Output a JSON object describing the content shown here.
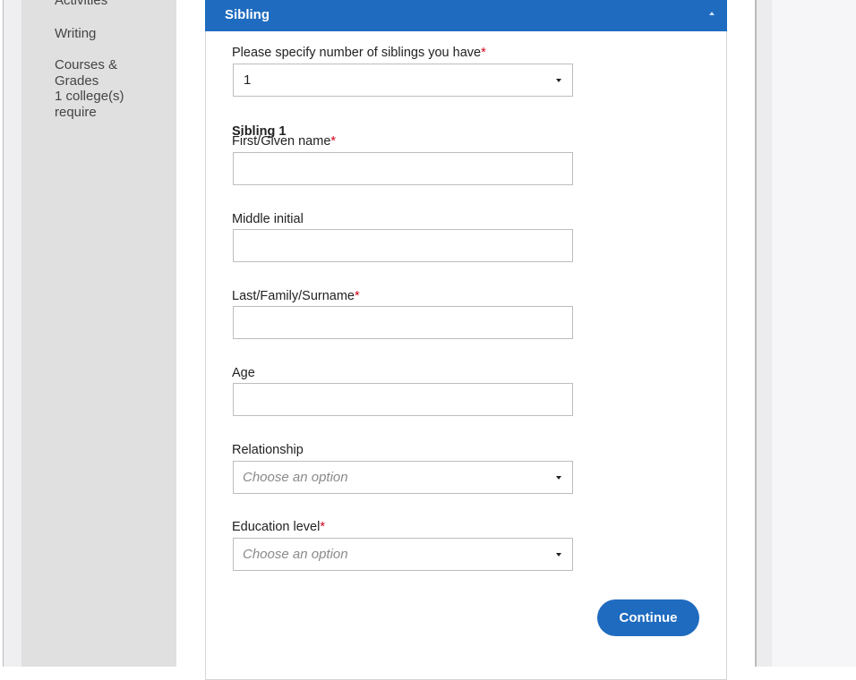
{
  "sidebar": {
    "items": [
      {
        "label": "Activities"
      },
      {
        "label": "Writing"
      },
      {
        "label": "Courses & Grades"
      },
      {
        "label": "1 college(s) require"
      }
    ]
  },
  "section": {
    "title": "Sibling",
    "collapse_icon": "caret-up-icon"
  },
  "form": {
    "sibling_count": {
      "label": "Please specify number of siblings you have",
      "required": "*",
      "value": "1"
    },
    "sibling_heading": "Sibling 1",
    "first_name": {
      "label": "First/Given name",
      "required": "*",
      "value": ""
    },
    "middle_initial": {
      "label": "Middle initial",
      "value": ""
    },
    "last_name": {
      "label": "Last/Family/Surname",
      "required": "*",
      "value": ""
    },
    "age": {
      "label": "Age",
      "value": ""
    },
    "relationship": {
      "label": "Relationship",
      "placeholder": "Choose an option"
    },
    "education_level": {
      "label": "Education level",
      "required": "*",
      "placeholder": "Choose an option"
    },
    "continue_label": "Continue"
  },
  "colors": {
    "accent": "#1e6bbf",
    "required": "#d0021b"
  }
}
